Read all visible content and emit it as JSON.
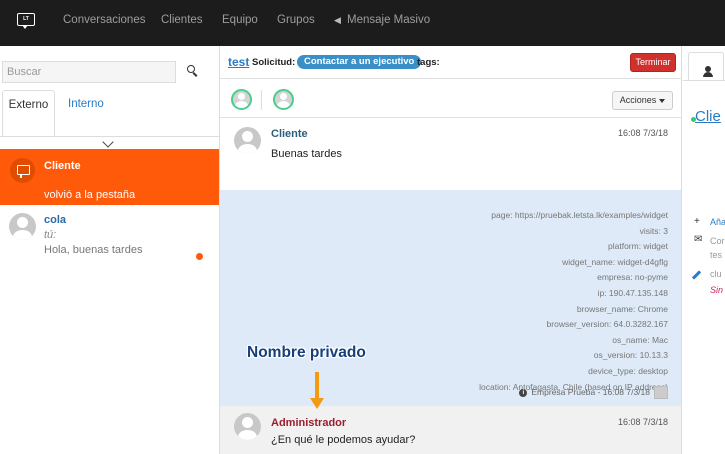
{
  "navbar": {
    "logo_text": "Let's Talk",
    "items": [
      "Conversaciones",
      "Clientes",
      "Equipo",
      "Grupos",
      "Mensaje Masivo"
    ]
  },
  "left": {
    "search_placeholder": "Buscar",
    "tabs": [
      "Externo",
      "Interno"
    ],
    "active_conversation": {
      "name": "Cliente",
      "status": "volvió a la pestaña"
    },
    "conversation": {
      "name": "cola",
      "sender": "tú:",
      "preview": "Hola, buenas tardes"
    }
  },
  "center": {
    "header": {
      "title": "test",
      "request_label": "Solicitud:",
      "request_value": "Contactar a un ejecutivo",
      "tags_label": "tags:",
      "end_button": "Terminar"
    },
    "actions_button": "Acciones",
    "messages": [
      {
        "name": "Cliente",
        "time": "16:08 7/3/18",
        "text": "Buenas tardes"
      },
      {
        "name": "Administrador",
        "time": "16:08 7/3/18",
        "text": "¿En qué le podemos ayudar?"
      }
    ],
    "metadata": [
      "page: https://pruebak.letsta.lk/examples/widget",
      "visits: 3",
      "platform: widget",
      "widget_name: widget-d4gflg",
      "empresa: no-pyme",
      "ip: 190.47.135.148",
      "browser_name: Chrome",
      "browser_version: 64.0.3282.167",
      "os_name: Mac",
      "os_version: 10.13.3",
      "device_type: desktop",
      "location: Antofagasta, Chile (based on IP address)"
    ],
    "metadata_footer": "Empresa Prueba - 16:08 7/3/18",
    "private_name_label": "Nombre privado"
  },
  "right": {
    "link_text": "Clie",
    "rows": [
      "Aña",
      "Cor",
      "tes",
      "clu",
      "Sin"
    ]
  },
  "colors": {
    "navbar": "#1c1c1c",
    "accent_orange": "#ff5a0a",
    "link_blue": "#2a7bc4",
    "end_button": "#d0312d",
    "metadata_bg": "#deeaf8",
    "client_name": "#2b5f7c",
    "admin_name": "#9b1c2e"
  }
}
